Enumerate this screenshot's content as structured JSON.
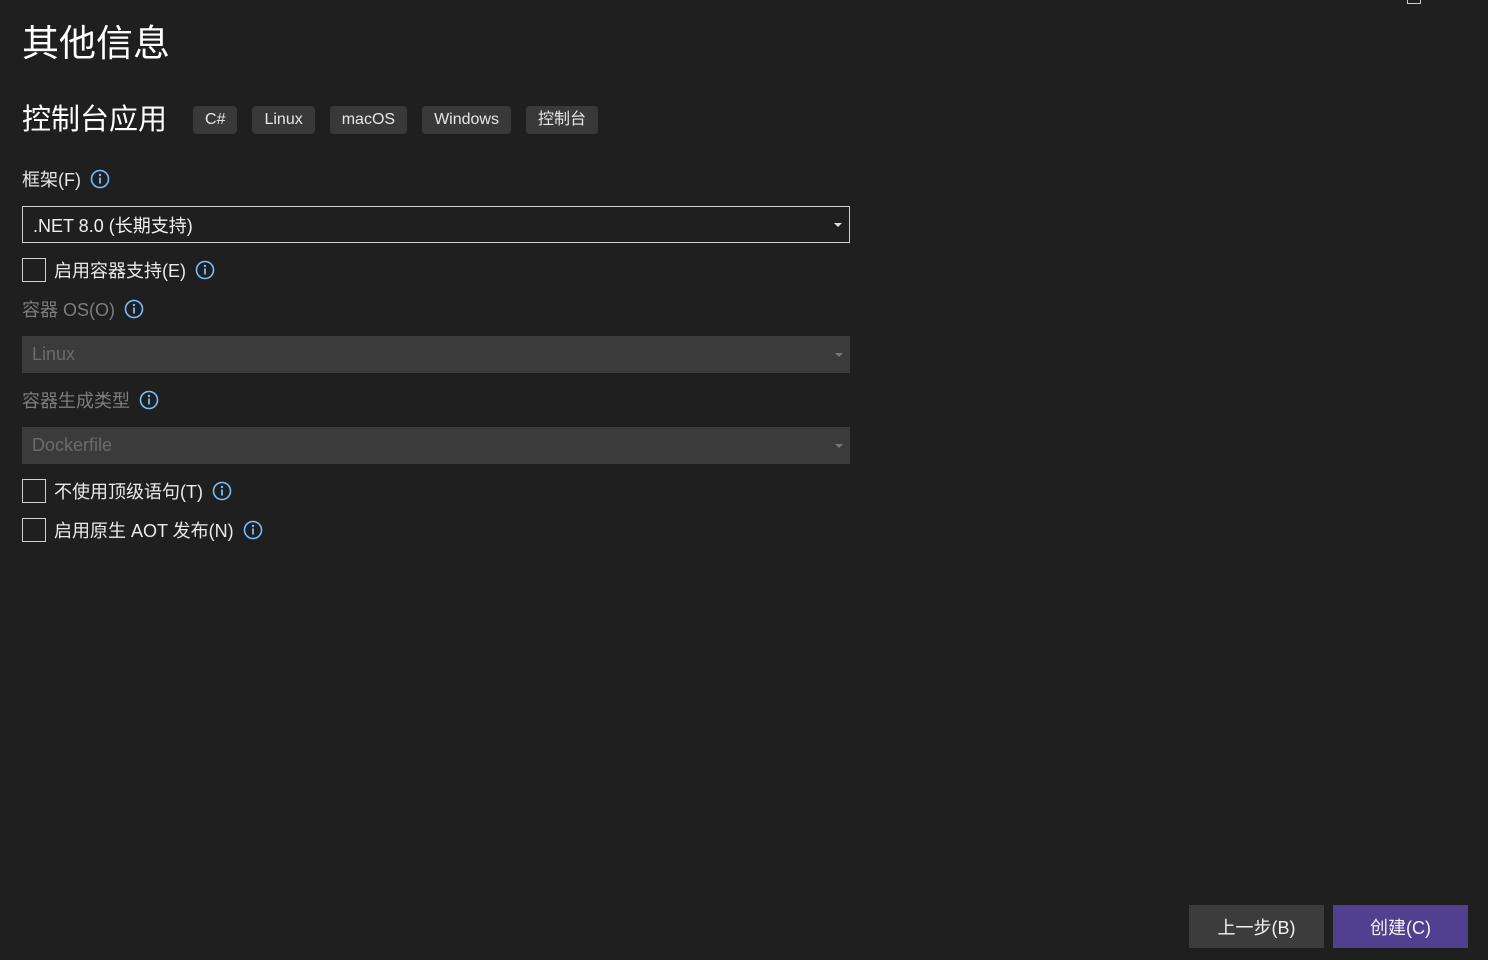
{
  "page": {
    "title": "其他信息"
  },
  "template": {
    "name": "控制台应用",
    "tags": [
      "C#",
      "Linux",
      "macOS",
      "Windows",
      "控制台"
    ]
  },
  "framework": {
    "label": "框架(F)",
    "value": ".NET 8.0 (长期支持)"
  },
  "container_support": {
    "label": "启用容器支持(E)",
    "checked": false
  },
  "container_os": {
    "label": "容器 OS(O)",
    "value": "Linux",
    "enabled": false
  },
  "container_build_type": {
    "label": "容器生成类型",
    "value": "Dockerfile",
    "enabled": false
  },
  "no_top_level_statements": {
    "label": "不使用顶级语句(T)",
    "checked": false
  },
  "native_aot": {
    "label": "启用原生 AOT 发布(N)",
    "checked": false
  },
  "footer": {
    "back_label": "上一步(B)",
    "create_label": "创建(C)"
  },
  "colors": {
    "background": "#1f1f1f",
    "info_icon": "#75beff",
    "primary_button": "#51408f",
    "secondary_button": "#3c3c3c",
    "tag_background": "#393939",
    "disabled_select": "#3b3b3b"
  },
  "icons": {
    "info": "info-circle-icon",
    "dropdown": "chevron-down-icon",
    "maximize": "maximize-icon",
    "close": "close-icon"
  }
}
